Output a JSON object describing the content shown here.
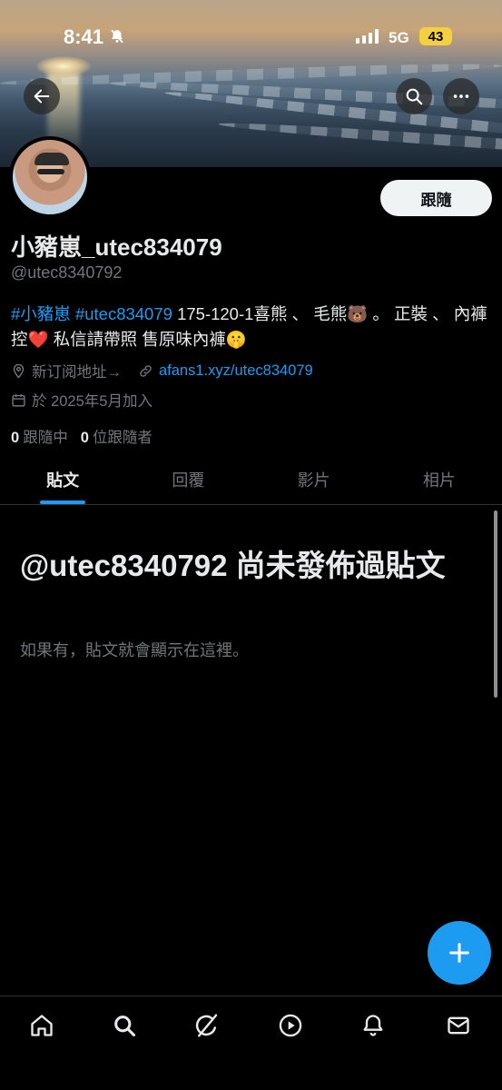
{
  "status_bar": {
    "time": "8:41",
    "network": "5G",
    "battery": "43"
  },
  "profile": {
    "display_name": "小豬崽_utec834079",
    "handle": "@utec8340792",
    "follow_button": "跟隨",
    "bio": {
      "tag1": "#小豬崽",
      "tag2": "#utec834079",
      "text1": " 175-120-1喜熊 、 毛熊🐻 。 正裝 、 內褲控❤️ 私信請帶照 售原味內褲🤫"
    },
    "location": "新订阅地址→",
    "website": "afans1.xyz/utec834079",
    "joined": "於 2025年5月加入",
    "following_count": "0",
    "following_label": "跟隨中",
    "followers_count": "0",
    "followers_label": "位跟隨者"
  },
  "tabs": [
    {
      "label": "貼文",
      "active": true
    },
    {
      "label": "回覆",
      "active": false
    },
    {
      "label": "影片",
      "active": false
    },
    {
      "label": "相片",
      "active": false
    }
  ],
  "empty_state": {
    "title": "@utec8340792 尚未發佈過貼文",
    "subtitle": "如果有，貼文就會顯示在這裡。"
  },
  "colors": {
    "accent": "#1d9bf0",
    "background": "#000000",
    "muted": "#71767b"
  },
  "icons": {
    "back": "arrow-left-icon",
    "search": "search-icon",
    "more": "more-horizontal-icon",
    "location": "location-pin-icon",
    "link": "link-icon",
    "calendar": "calendar-icon",
    "compose": "plus-icon",
    "home": "home-icon",
    "explore": "search-icon",
    "grok": "grok-icon",
    "video": "play-icon",
    "notifications": "bell-icon",
    "messages": "mail-icon"
  }
}
